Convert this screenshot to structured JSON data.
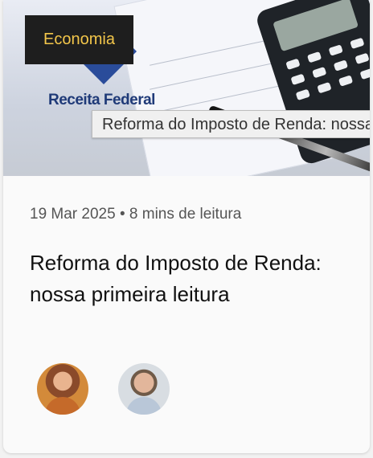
{
  "article": {
    "category_badge": "Economia",
    "image_logo_text": "Receita Federal",
    "tooltip_text": "Reforma do Imposto de Renda: nossa primeira leitura",
    "meta": "19 Mar 2025 • 8 mins de leitura",
    "title": "Reforma do Imposto de Renda: nossa primeira leitura",
    "authors": [
      {
        "avatar_icon": "author-avatar-woman"
      },
      {
        "avatar_icon": "author-avatar-man"
      }
    ]
  },
  "colors": {
    "badge_bg": "#1e1e1e",
    "badge_text": "#f3c64a",
    "title_text": "#111111",
    "meta_text": "#555555"
  }
}
